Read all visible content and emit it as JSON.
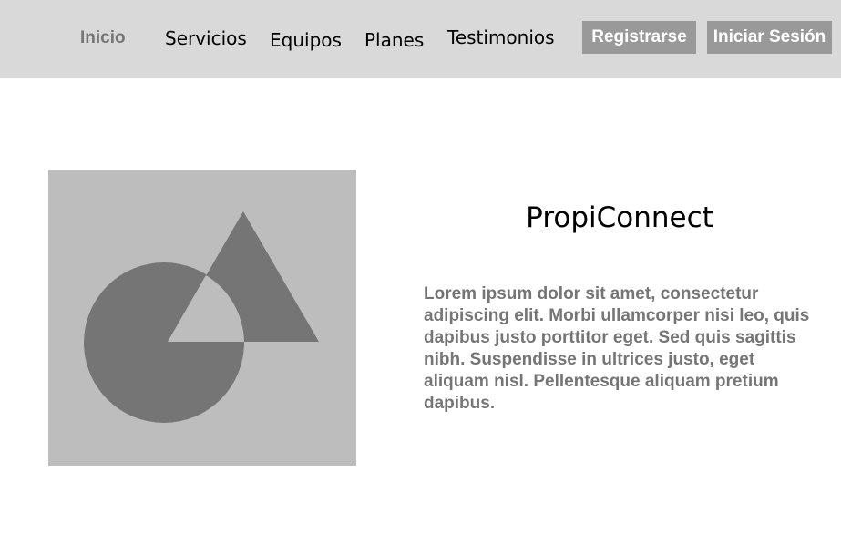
{
  "nav": {
    "items": [
      {
        "label": "Inicio",
        "active": true
      },
      {
        "label": "Servicios",
        "active": false
      },
      {
        "label": "Equipos",
        "active": false
      },
      {
        "label": "Planes",
        "active": false
      },
      {
        "label": "Testimonios",
        "active": false
      }
    ],
    "register_label": "Registrarse",
    "login_label": "Iniciar Sesión"
  },
  "hero": {
    "image_icon": "image-placeholder-icon",
    "title": "PropiConnect",
    "description": "Lorem ipsum dolor sit amet, consectetur adipiscing elit. Morbi ullamcorper nisi leo, quis dapibus justo porttitor eget. Sed quis sagittis nibh. Suspendisse in ultrices justo, eget aliquam nisl. Pellentesque aliquam pretium dapibus."
  },
  "colors": {
    "navbar_bg": "#d9d9d9",
    "button_bg": "#999999",
    "placeholder_bg": "#bdbdbd",
    "shape_fill": "#757575",
    "muted_text": "#757575"
  }
}
